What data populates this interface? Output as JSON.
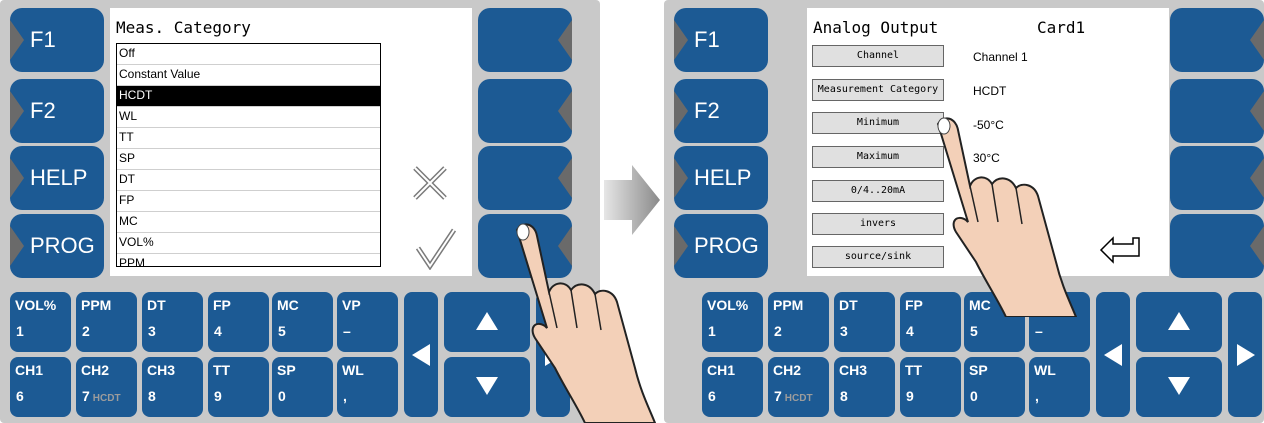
{
  "fkeys": [
    "F1",
    "F2",
    "HELP",
    "PROG"
  ],
  "keypad": {
    "row1": [
      {
        "label": "VOL%",
        "digit": "1"
      },
      {
        "label": "PPM",
        "digit": "2"
      },
      {
        "label": "DT",
        "digit": "3"
      },
      {
        "label": "FP",
        "digit": "4"
      },
      {
        "label": "MC",
        "digit": "5"
      },
      {
        "label": "VP",
        "digit": "–"
      }
    ],
    "row2": [
      {
        "label": "CH1",
        "digit": "6"
      },
      {
        "label": "CH2",
        "digit": "7",
        "sub": "HCDT"
      },
      {
        "label": "CH3",
        "digit": "8"
      },
      {
        "label": "TT",
        "digit": "9"
      },
      {
        "label": "SP",
        "digit": "0"
      },
      {
        "label": "WL",
        "digit": ","
      }
    ]
  },
  "left_screen": {
    "title": "Meas. Category",
    "items": [
      "Off",
      "Constant Value",
      "HCDT",
      "WL",
      "TT",
      "SP",
      "DT",
      "FP",
      "MC",
      "VOL%",
      "PPM"
    ],
    "selected_index": 2
  },
  "right_screen": {
    "title": "Analog Output",
    "card": "Card1",
    "rows": [
      {
        "button": "Channel",
        "value": "Channel 1"
      },
      {
        "button": "Measurement Category",
        "value": "HCDT"
      },
      {
        "button": "Minimum",
        "value": "-50°C"
      },
      {
        "button": "Maximum",
        "value": "30°C"
      },
      {
        "button": "0/4..20mA",
        "value": ""
      },
      {
        "button": "invers",
        "value": ""
      },
      {
        "button": "source/sink",
        "value": ""
      }
    ]
  },
  "icons": {
    "cancel": "cross-icon",
    "confirm": "checkmark-icon",
    "back": "return-arrow-icon",
    "transition": "right-arrow-icon",
    "hand": "pointing-hand-icon"
  },
  "colors": {
    "key_blue": "#1c5a94",
    "panel_gray": "#c9c9c9",
    "notch_gray": "#6a6a6a"
  }
}
